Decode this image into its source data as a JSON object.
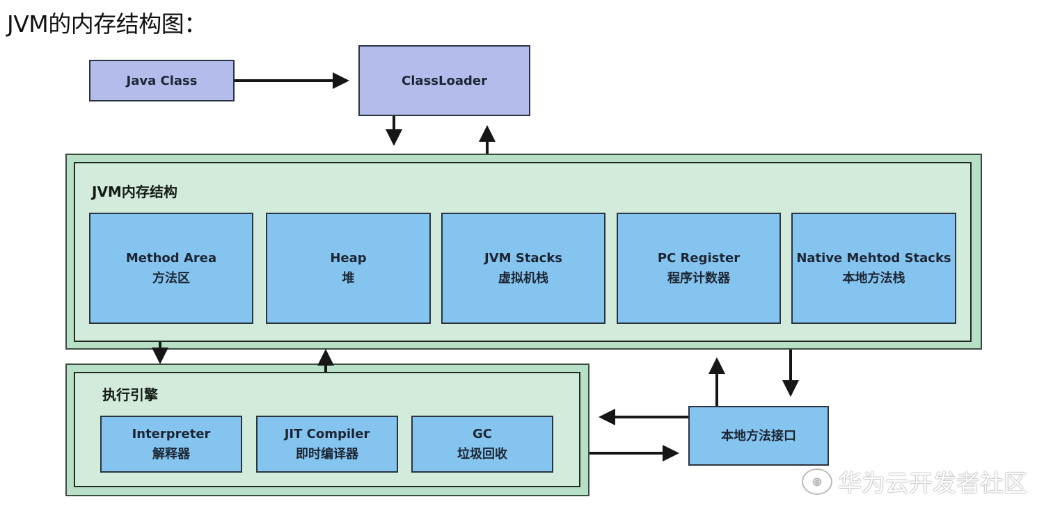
{
  "title": "JVM的内存结构图：",
  "nodes": {
    "java_class": "Java Class",
    "class_loader": "ClassLoader",
    "native_interface": "本地方法接口"
  },
  "memory_structure": {
    "label": "JVM内存结构",
    "areas": [
      {
        "en": "Method Area",
        "zh": "方法区"
      },
      {
        "en": "Heap",
        "zh": "堆"
      },
      {
        "en": "JVM Stacks",
        "zh": "虚拟机栈"
      },
      {
        "en": "PC Register",
        "zh": "程序计数器"
      },
      {
        "en": "Native Mehtod Stacks",
        "zh": "本地方法栈"
      }
    ]
  },
  "execution_engine": {
    "label": "执行引擎",
    "components": [
      {
        "en": "Interpreter",
        "zh": "解释器"
      },
      {
        "en": "JIT Compiler",
        "zh": "即时编译器"
      },
      {
        "en": "GC",
        "zh": "垃圾回收"
      }
    ]
  },
  "edges": [
    {
      "from": "Java Class",
      "to": "ClassLoader"
    },
    {
      "from": "ClassLoader",
      "to": "JVM内存结构"
    },
    {
      "from": "JVM内存结构",
      "to": "ClassLoader"
    },
    {
      "from": "JVM内存结构",
      "to": "执行引擎"
    },
    {
      "from": "执行引擎",
      "to": "JVM内存结构"
    },
    {
      "from": "本地方法接口",
      "to": "JVM内存结构"
    },
    {
      "from": "JVM内存结构",
      "to": "本地方法接口"
    },
    {
      "from": "本地方法接口",
      "to": "执行引擎"
    },
    {
      "from": "执行引擎",
      "to": "本地方法接口"
    }
  ],
  "watermark": {
    "icon": "weibo-icon",
    "text": "华为云开发者社区"
  }
}
